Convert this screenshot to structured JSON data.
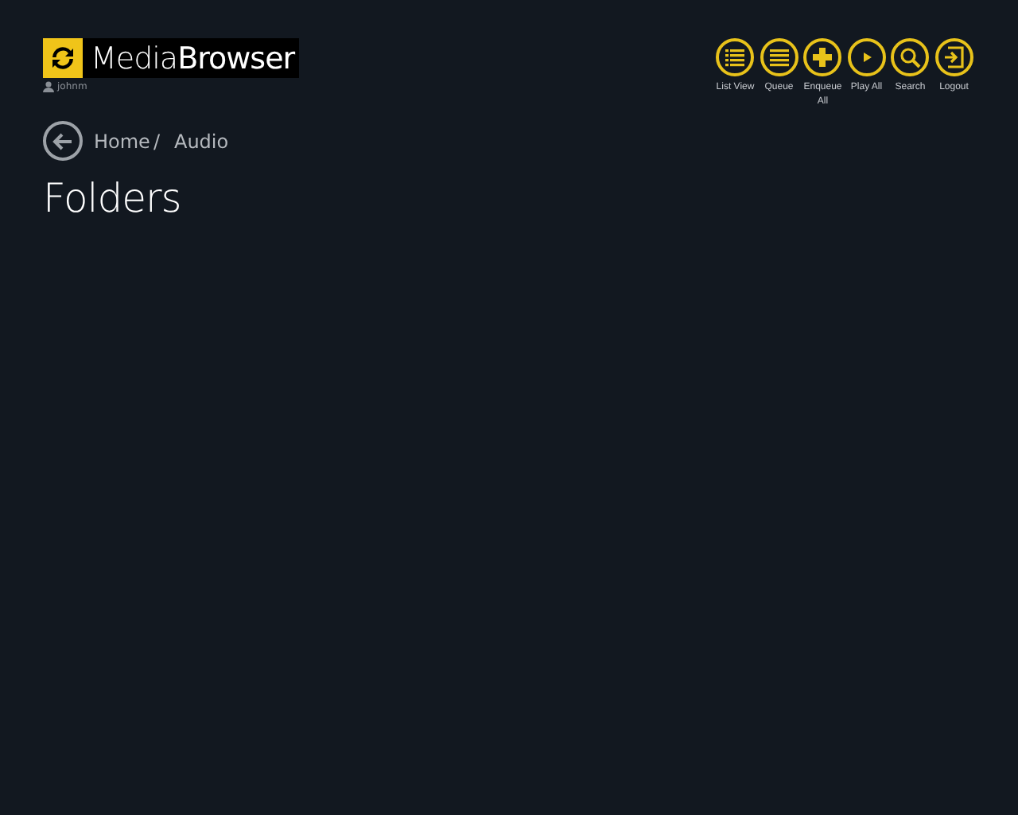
{
  "logo": {
    "text": "Media**Browser**"
  },
  "user": {
    "name": "johnm"
  },
  "toolbar": [
    {
      "kind": "list",
      "label": "List View"
    },
    {
      "kind": "queue",
      "label": "Queue"
    },
    {
      "kind": "add",
      "label": "Enqueue All"
    },
    {
      "kind": "play",
      "label": "Play All"
    },
    {
      "kind": "search",
      "label": "Search"
    },
    {
      "kind": "logout",
      "label": "Logout"
    }
  ],
  "breadcrumb": [
    {
      "label": "Home"
    },
    {
      "label": "Audio"
    }
  ],
  "breadcrumb_separator": "/",
  "title": "Folders"
}
